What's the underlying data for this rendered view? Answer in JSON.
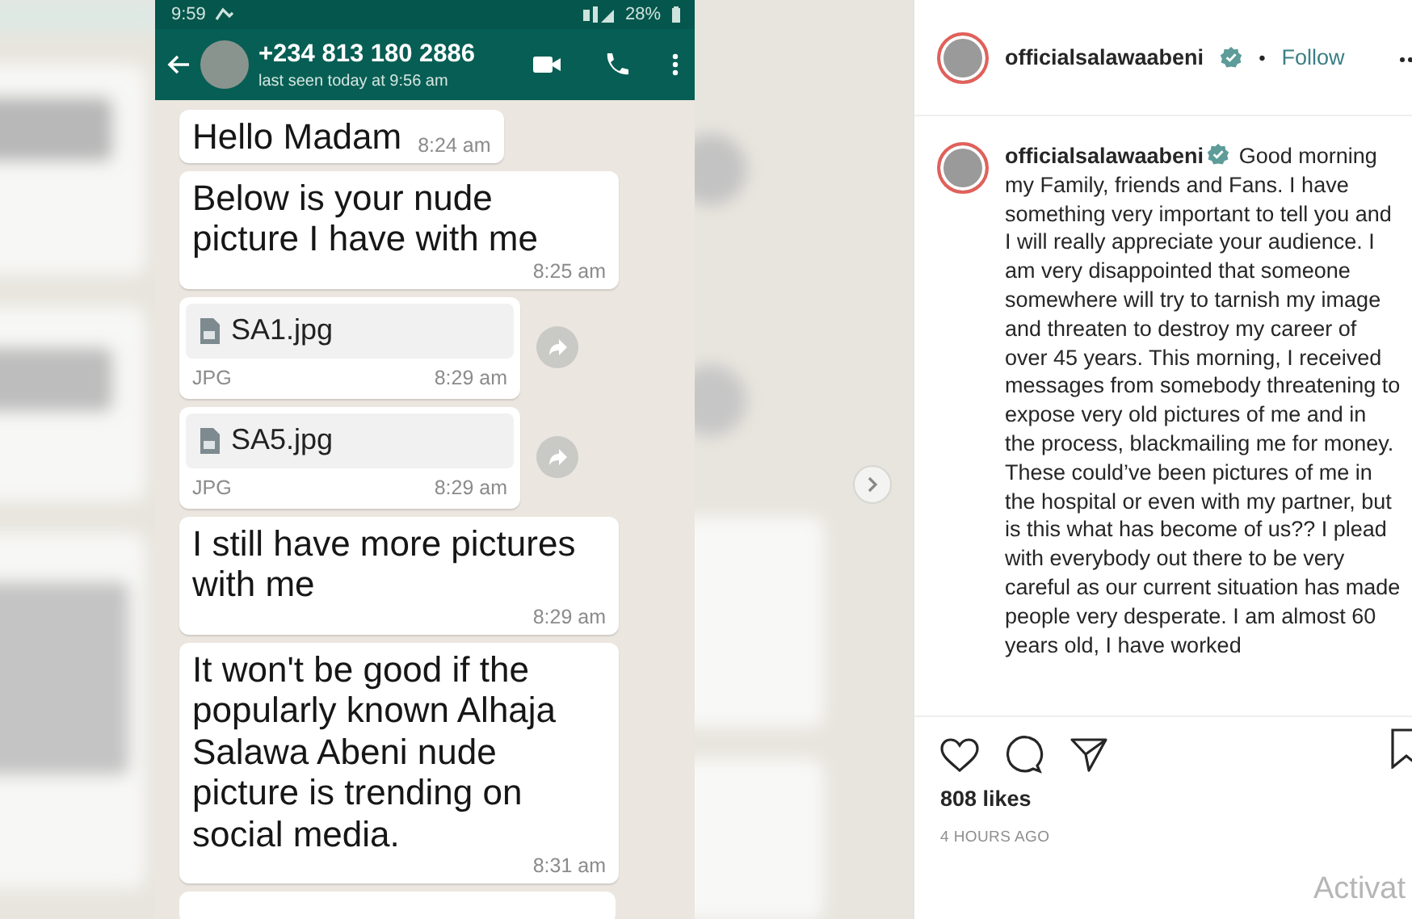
{
  "chat_screenshot": {
    "status_bar": {
      "time": "9:59",
      "battery": "28%"
    },
    "contact": {
      "phone": "+234 813 180 2886",
      "last_seen": "last seen today at 9:56 am"
    },
    "messages": [
      {
        "kind": "text",
        "text": "Hello Madam",
        "time": "8:24 am"
      },
      {
        "kind": "text",
        "text": "Below is your nude picture I have with me",
        "time": "8:25 am"
      },
      {
        "kind": "file",
        "file_name": "SA1.jpg",
        "file_type": "JPG",
        "time": "8:29 am"
      },
      {
        "kind": "file",
        "file_name": "SA5.jpg",
        "file_type": "JPG",
        "time": "8:29 am"
      },
      {
        "kind": "text",
        "text": "I still have more pictures with me",
        "time": "8:29 am"
      },
      {
        "kind": "text",
        "text": "It won't be good if the popularly known Alhaja Salawa Abeni nude picture is trending on social media.",
        "time": "8:31 am"
      }
    ]
  },
  "post": {
    "username": "officialsalawaabeni",
    "separator": "•",
    "follow": "Follow",
    "caption": "**officialsalawaabeni** Good morning my Family, friends and Fans. I have something very important to tell you and I will really appreciate your audience. I am very disappointed that someone somewhere will try to tarnish my image and threaten to destroy my career of over 45 years. This morning, I received messages from somebody threatening to expose very old pictures of me and in the process, blackmailing me for money. These could’ve been pictures of me in the hospital or even with my partner, but is this what has become of us?? I plead with everybody out there to be very careful as our current situation has made people very desperate. I am almost 60 years old, I have worked",
    "likes": "808 likes",
    "time_ago": "4 HOURS AGO"
  },
  "overlay_text": "Activat"
}
